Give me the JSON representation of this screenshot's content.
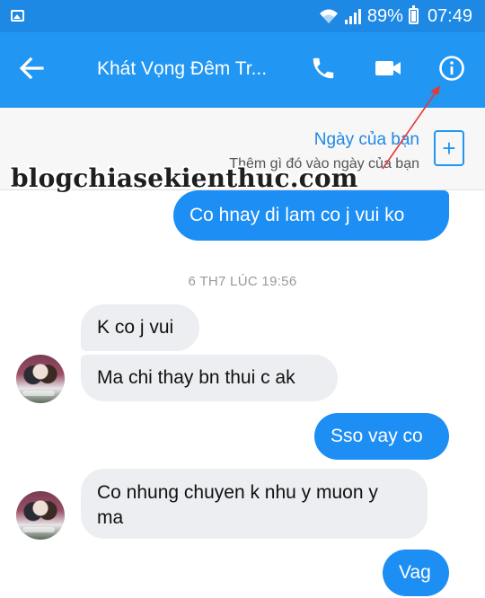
{
  "status_bar": {
    "battery": "89%",
    "time": "07:49"
  },
  "header": {
    "title": "Khát Vọng Đêm Tr..."
  },
  "day_panel": {
    "title": "Ngày của bạn",
    "subtitle": "Thêm gì đó vào ngày của bạn",
    "add_label": "+"
  },
  "watermark": "blogchiasekienthuc.com",
  "messages": [
    {
      "text": "Co hnay di lam co j vui ko",
      "side": "out"
    },
    {
      "text": "K co j vui",
      "side": "in"
    },
    {
      "text": "Ma chi thay bn thui c ak",
      "side": "in"
    },
    {
      "text": "Sso vay co",
      "side": "out"
    },
    {
      "text": "Co nhung chuyen k nhu y muon y",
      "text2": "ma",
      "side": "in"
    },
    {
      "text": "Vag",
      "side": "out"
    }
  ],
  "time_divider": "6 TH7 LÚC 19:56",
  "colors": {
    "header": "#2196f3",
    "status_bar": "#1e88e5",
    "outgoing_bubble": "#1d8ef3",
    "incoming_bubble": "#eceef1",
    "annotation_arrow": "#e53935"
  },
  "icons": {
    "back": "arrow-left-icon",
    "call": "phone-icon",
    "video": "video-camera-icon",
    "info": "info-icon",
    "add": "plus-icon"
  }
}
